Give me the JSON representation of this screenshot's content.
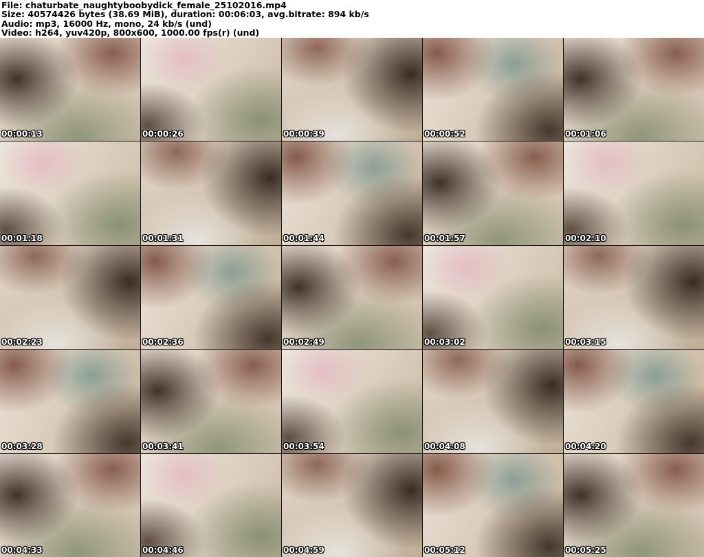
{
  "header": {
    "lines": [
      "File: chaturbate_naughtyboobydick_female_25102016.mp4",
      "Size: 40574426 bytes (38.69 MiB), duration: 00:06:03, avg.bitrate: 894 kb/s",
      "Audio: mp3, 16000 Hz, mono, 24 kb/s (und)",
      "Video: h264, yuv420p, 800x600, 1000.00 fps(r) (und)"
    ]
  },
  "thumbnails": [
    {
      "time": "00:00:13"
    },
    {
      "time": "00:00:26"
    },
    {
      "time": "00:00:39"
    },
    {
      "time": "00:00:52"
    },
    {
      "time": "00:01:06"
    },
    {
      "time": "00:01:18"
    },
    {
      "time": "00:01:31"
    },
    {
      "time": "00:01:44"
    },
    {
      "time": "00:01:57"
    },
    {
      "time": "00:02:10"
    },
    {
      "time": "00:02:23"
    },
    {
      "time": "00:02:36"
    },
    {
      "time": "00:02:49"
    },
    {
      "time": "00:03:02"
    },
    {
      "time": "00:03:15"
    },
    {
      "time": "00:03:28"
    },
    {
      "time": "00:03:41"
    },
    {
      "time": "00:03:54"
    },
    {
      "time": "00:04:08"
    },
    {
      "time": "00:04:20"
    },
    {
      "time": "00:04:33"
    },
    {
      "time": "00:04:46"
    },
    {
      "time": "00:04:59"
    },
    {
      "time": "00:05:12"
    },
    {
      "time": "00:05:25"
    }
  ],
  "colors": {
    "header_background": "#ffffff",
    "header_text": "#000000",
    "timestamp_text": "#ffffff",
    "timestamp_outline": "#000000",
    "grid_separator": "#141414"
  }
}
